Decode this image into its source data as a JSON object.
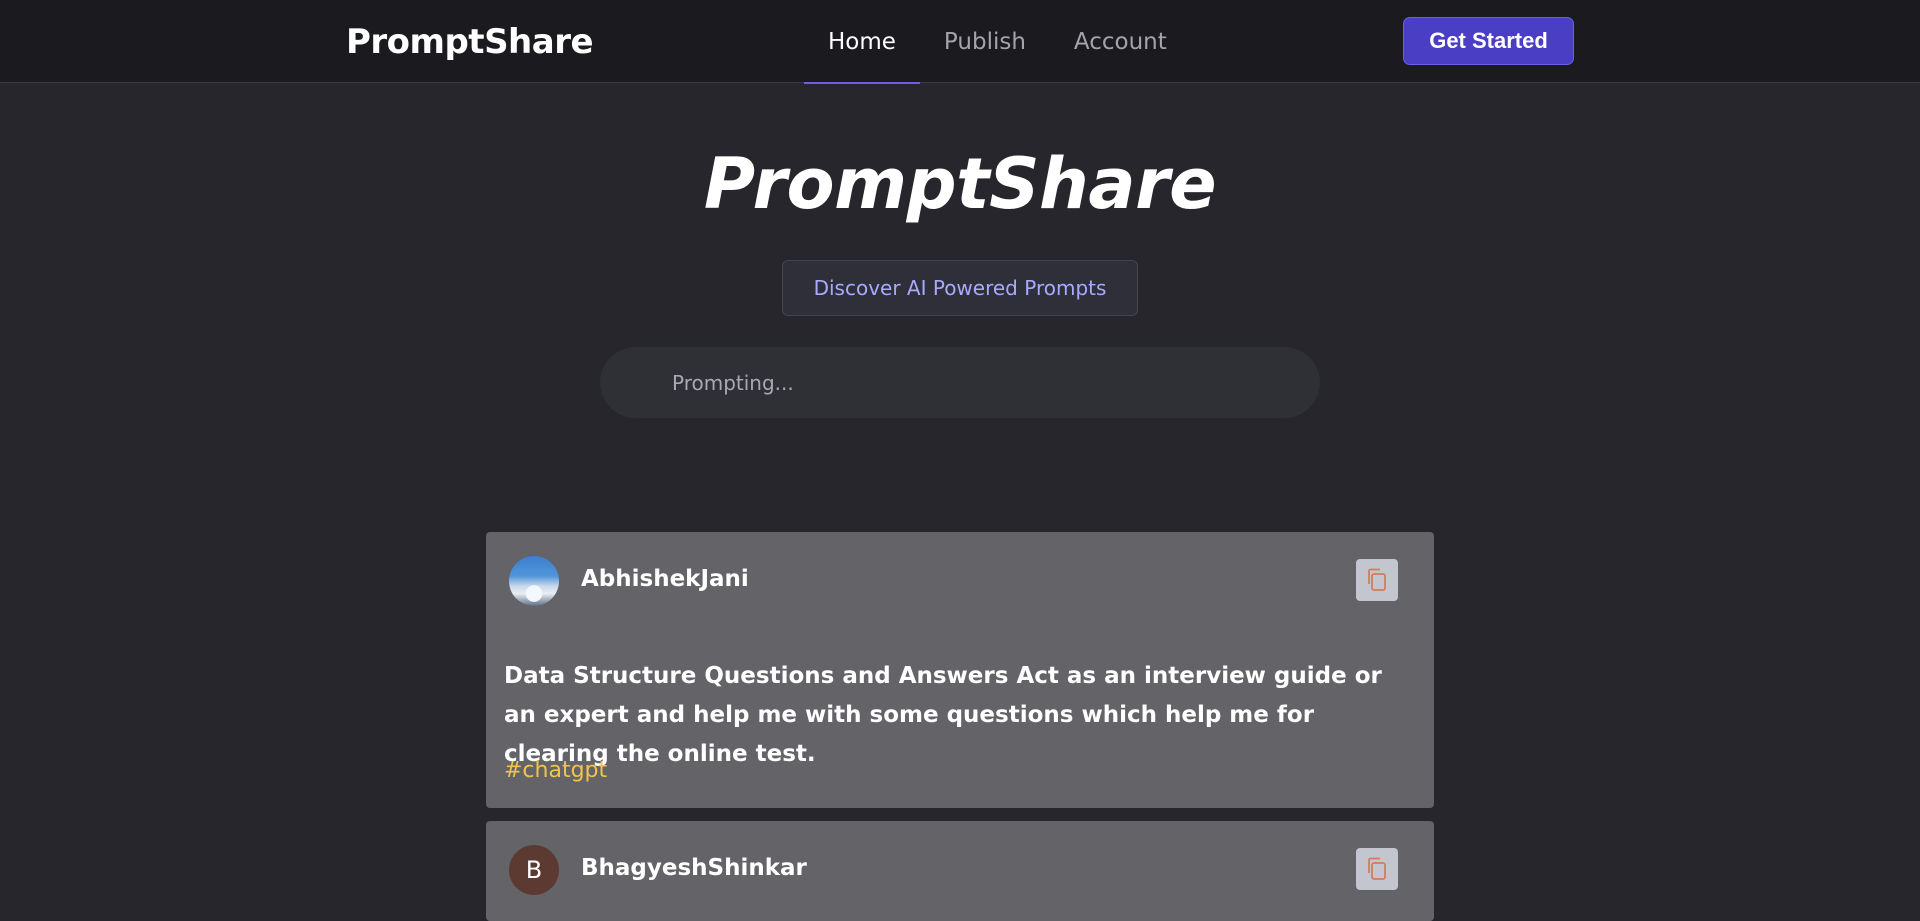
{
  "nav": {
    "logo": "PromptShare",
    "links": [
      {
        "label": "Home",
        "active": true
      },
      {
        "label": "Publish",
        "active": false
      },
      {
        "label": "Account",
        "active": false
      }
    ],
    "cta_label": "Get Started"
  },
  "hero": {
    "title": "PromptShare",
    "subtitle": "Discover AI Powered Prompts"
  },
  "search": {
    "placeholder": "Prompting..."
  },
  "posts": [
    {
      "username": "AbhishekJani",
      "avatar": "photo",
      "text": "Data Structure Questions and Answers Act as an interview guide or an expert and help me with some questions which help me for clearing the online test.",
      "tag": "#chatgpt",
      "copy_icon": "copy-icon"
    },
    {
      "username": "BhagyeshShinkar",
      "avatar_letter": "B",
      "copy_icon": "copy-icon"
    }
  ],
  "colors": {
    "background": "#26262c",
    "nav_bg": "#1b1b1f",
    "accent": "#4a3fc4",
    "card_bg": "#636368",
    "tag": "#f3c44b",
    "pill_text": "#a9a9ff"
  }
}
